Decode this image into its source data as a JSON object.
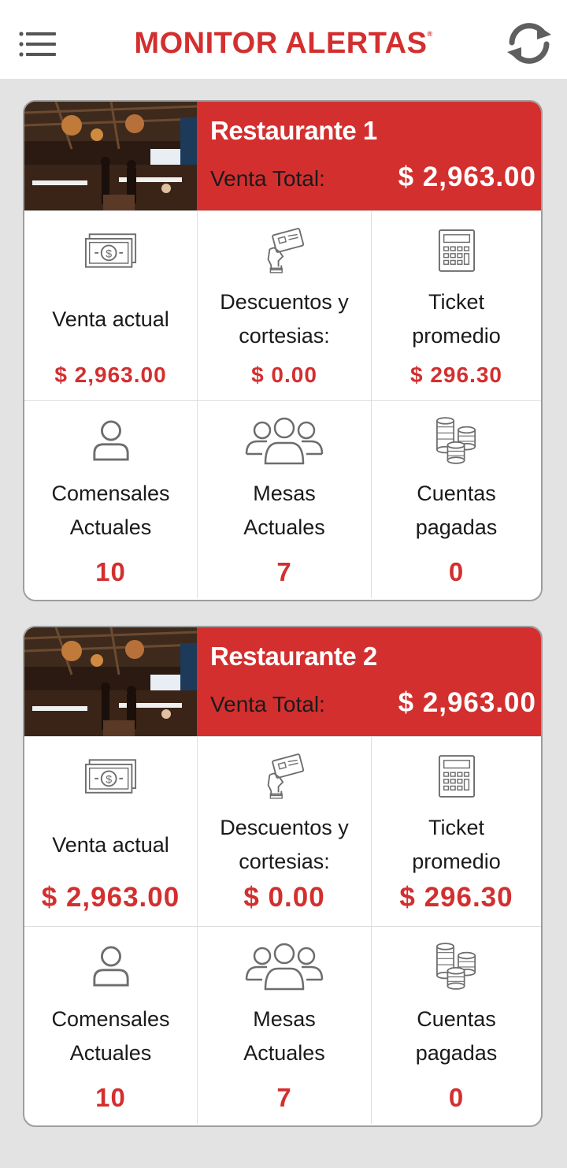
{
  "app": {
    "title": "MONITOR ALERTAS",
    "reg_mark": "®"
  },
  "icons": {
    "menu": "hamburger-menu-icon",
    "refresh": "refresh-icon"
  },
  "colors": {
    "brand_red": "#d32f2f",
    "background": "#e3e3e3",
    "text": "#1a1a1a"
  },
  "labels": {
    "venta_total": "Venta Total:",
    "venta_actual": "Venta actual",
    "descuentos_1": "Descuentos y",
    "descuentos_2": "cortesias:",
    "ticket_1": "Ticket",
    "ticket_2": "promedio",
    "comensales_1": "Comensales",
    "comensales_2": "Actuales",
    "mesas_1": "Mesas",
    "mesas_2": "Actuales",
    "cuentas_1": "Cuentas",
    "cuentas_2": "pagadas"
  },
  "restaurants": [
    {
      "name": "Restaurante 1",
      "venta_total": "$ 2,963.00",
      "venta_actual": "$ 2,963.00",
      "descuentos": "$ 0.00",
      "ticket_promedio": "$ 296.30",
      "comensales": "10",
      "mesas": "7",
      "cuentas_pagadas": "0"
    },
    {
      "name": "Restaurante 2",
      "venta_total": "$ 2,963.00",
      "venta_actual": "$ 2,963.00",
      "descuentos": "$ 0.00",
      "ticket_promedio": "$ 296.30",
      "comensales": "10",
      "mesas": "7",
      "cuentas_pagadas": "0"
    }
  ]
}
